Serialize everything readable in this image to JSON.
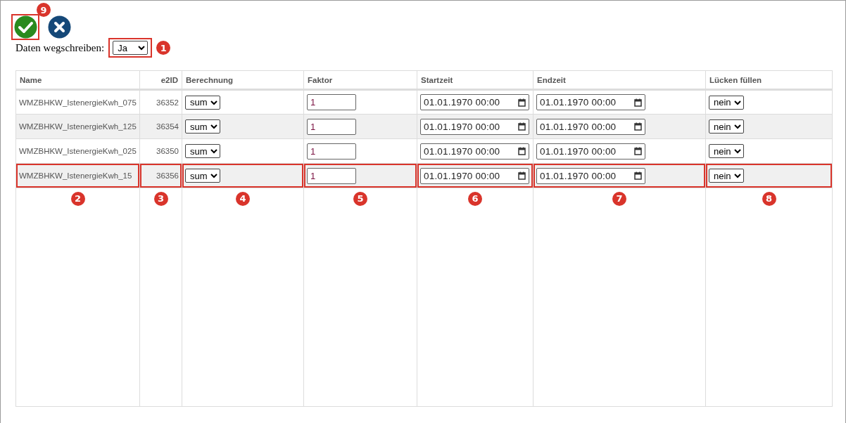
{
  "toolbar": [
    {
      "kind": "confirm",
      "highlighted": true,
      "callout": "9"
    },
    {
      "kind": "cancel",
      "highlighted": false
    }
  ],
  "write_data": {
    "label": "Daten wegschreiben:",
    "value": "Ja",
    "highlighted": true,
    "callout": "1"
  },
  "table": {
    "columns": [
      {
        "label": "Name",
        "callout": "2"
      },
      {
        "label": "e2ID",
        "callout": "3"
      },
      {
        "label": "Berechnung",
        "callout": "4"
      },
      {
        "label": "Faktor",
        "callout": "5"
      },
      {
        "label": "Startzeit",
        "callout": "6"
      },
      {
        "label": "Endzeit",
        "callout": "7"
      },
      {
        "label": "Lücken füllen",
        "callout": "8"
      }
    ],
    "rows": [
      {
        "name": "WMZBHKW_IstenergieKwh_075",
        "id": "36352",
        "calculation": "sum",
        "factor": "1",
        "start": "01.01.1970 00:00",
        "end": "01.01.1970 00:00",
        "fill_gaps": "nein",
        "highlighted": false
      },
      {
        "name": "WMZBHKW_IstenergieKwh_125",
        "id": "36354",
        "calculation": "sum",
        "factor": "1",
        "start": "01.01.1970 00:00",
        "end": "01.01.1970 00:00",
        "fill_gaps": "nein",
        "highlighted": false
      },
      {
        "name": "WMZBHKW_IstenergieKwh_025",
        "id": "36350",
        "calculation": "sum",
        "factor": "1",
        "start": "01.01.1970 00:00",
        "end": "01.01.1970 00:00",
        "fill_gaps": "nein",
        "highlighted": false
      },
      {
        "name": "WMZBHKW_IstenergieKwh_15",
        "id": "36356",
        "calculation": "sum",
        "factor": "1",
        "start": "01.01.1970 00:00",
        "end": "01.01.1970 00:00",
        "fill_gaps": "nein",
        "highlighted": true
      }
    ]
  }
}
